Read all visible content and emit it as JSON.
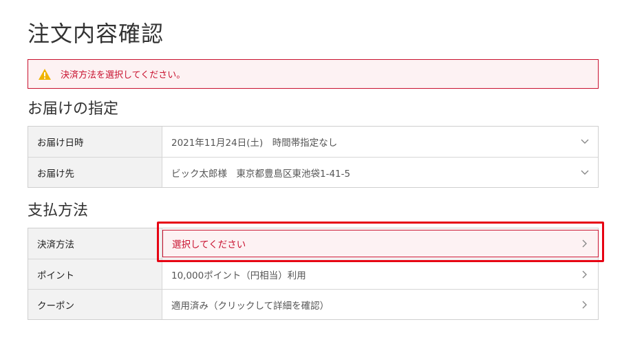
{
  "page": {
    "title": "注文内容確認"
  },
  "alert": {
    "message": "決済方法を選択してください。",
    "icon": "warning-triangle-icon"
  },
  "delivery": {
    "title": "お届けの指定",
    "rows": [
      {
        "label": "お届け日時",
        "value": "2021年11月24日(土)　時間帯指定なし"
      },
      {
        "label": "お届け先",
        "value": "ビック太郎様　東京都豊島区東池袋1-41-5"
      }
    ]
  },
  "payment": {
    "title": "支払方法",
    "rows": [
      {
        "label": "決済方法",
        "value": "選択してください"
      },
      {
        "label": "ポイント",
        "value": "10,000ポイント（円相当）利用"
      },
      {
        "label": "クーポン",
        "value": "適用済み（クリックして詳細を確認）"
      }
    ]
  },
  "colors": {
    "error": "#c8102e",
    "highlight": "#e60012",
    "label_bg": "#f2f2f2"
  }
}
